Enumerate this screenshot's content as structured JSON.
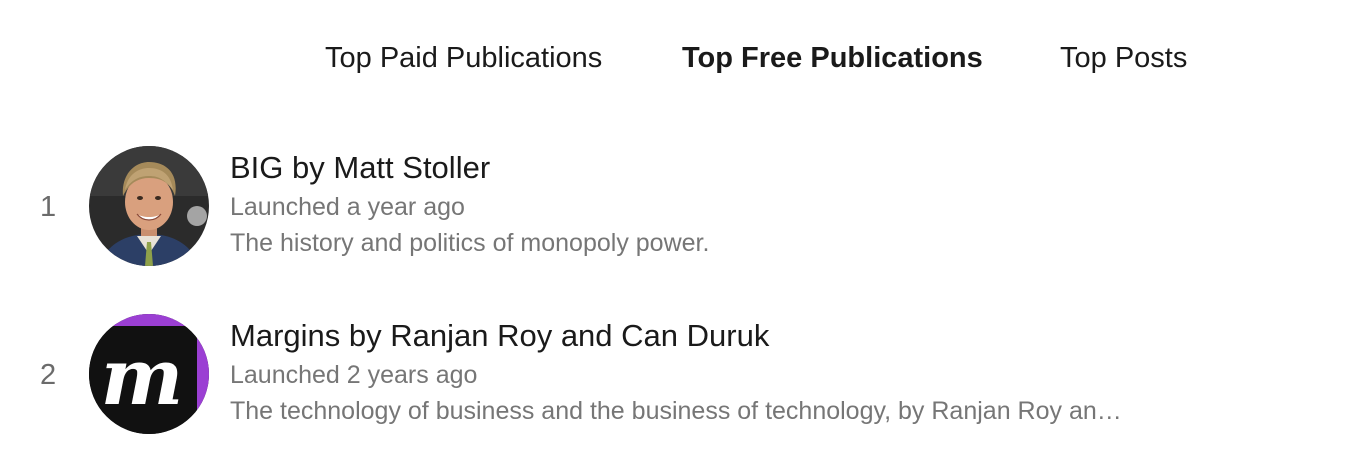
{
  "tabs": [
    {
      "label": "Top Paid Publications",
      "active": false
    },
    {
      "label": "Top Free Publications",
      "active": true
    },
    {
      "label": "Top Posts",
      "active": false
    }
  ],
  "publications": [
    {
      "rank": "1",
      "title": "BIG by Matt Stoller",
      "launched": "Launched a year ago",
      "description": "The history and politics of monopoly power.",
      "avatar": "author-photo"
    },
    {
      "rank": "2",
      "title": "Margins by Ranjan Roy and Can Duruk",
      "launched": "Launched 2 years ago",
      "description": "The technology of business and the business of technology, by Ranjan Roy an…",
      "avatar": "margins-logo",
      "avatar_letter": "m"
    }
  ],
  "colors": {
    "text": "#1a1a1a",
    "muted": "#767676",
    "logo_purple": "#9b3fd3",
    "logo_black": "#111111"
  }
}
